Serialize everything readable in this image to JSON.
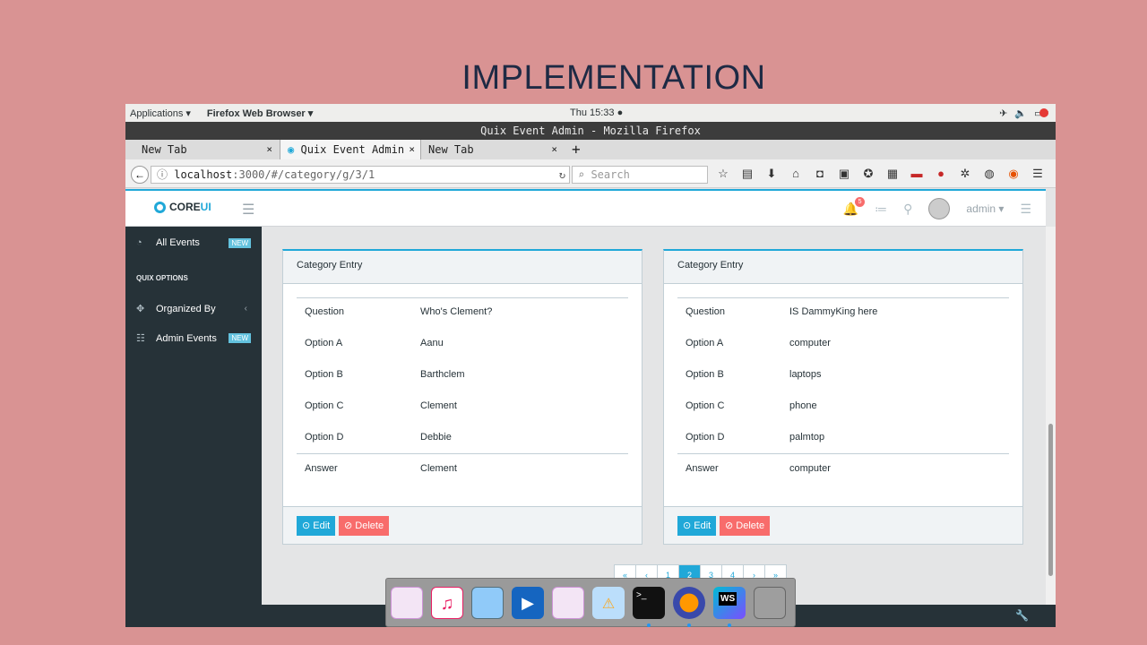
{
  "slide": {
    "title": "IMPLEMENTATION"
  },
  "gnome": {
    "applications": "Applications ▾",
    "app_name": "Firefox Web Browser ▾",
    "clock": "Thu 15:33 ●"
  },
  "window": {
    "title": "Quix Event Admin - Mozilla Firefox"
  },
  "tabs": [
    {
      "label": "New Tab",
      "close": "×"
    },
    {
      "label": "Quix Event Admin",
      "close": "×"
    },
    {
      "label": "New Tab",
      "close": "×"
    }
  ],
  "navbar": {
    "url_host": "localhost",
    "url_rest": ":3000/#/category/g/3/1",
    "search_placeholder": "Search"
  },
  "app": {
    "brand_core": "CORE",
    "brand_ui": "UI",
    "notifications_count": "5",
    "user": "admin ▾"
  },
  "sidebar": {
    "all_events": "All Events",
    "new_badge": "NEW",
    "section_title": "QUIX OPTIONS",
    "organized_by": "Organized By",
    "admin_events": "Admin Events"
  },
  "cards": [
    {
      "header": "Category Entry",
      "labels": {
        "question": "Question",
        "a": "Option A",
        "b": "Option B",
        "c": "Option C",
        "d": "Option D",
        "answer": "Answer"
      },
      "values": {
        "question": "Who's Clement?",
        "a": "Aanu",
        "b": "Barthclem",
        "c": "Clement",
        "d": "Debbie",
        "answer": "Clement"
      },
      "edit": "Edit",
      "delete": "Delete"
    },
    {
      "header": "Category Entry",
      "labels": {
        "question": "Question",
        "a": "Option A",
        "b": "Option B",
        "c": "Option C",
        "d": "Option D",
        "answer": "Answer"
      },
      "values": {
        "question": "IS DammyKing here",
        "a": "computer",
        "b": "laptops",
        "c": "phone",
        "d": "palmtop",
        "answer": "computer"
      },
      "edit": "Edit",
      "delete": "Delete"
    }
  ],
  "pager": [
    "«",
    "‹",
    "1",
    "2",
    "3",
    "4",
    "›",
    "»"
  ],
  "pager_active": "2",
  "colors": {
    "primary": "#20a8d8",
    "danger": "#f86c6b",
    "sidebar": "#263238"
  }
}
